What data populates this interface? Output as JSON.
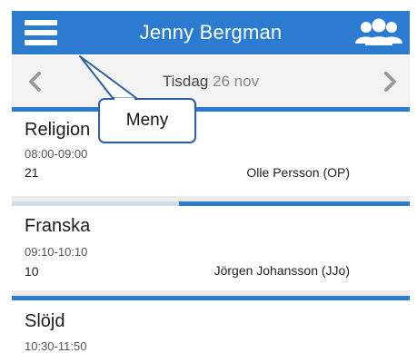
{
  "header": {
    "title": "Jenny Bergman",
    "accent_color": "#2b7cd0",
    "menu_icon": "hamburger-menu-icon",
    "group_icon": "users-group-icon"
  },
  "date_nav": {
    "day": "Tisdag",
    "date": "26 nov",
    "prev_icon": "chevron-left-icon",
    "next_icon": "chevron-right-icon"
  },
  "lessons": [
    {
      "subject": "Religion",
      "time": "08:00-09:00",
      "room": "21",
      "teacher": "Olle Persson (OP)"
    },
    {
      "subject": "Franska",
      "time": "09:10-10:10",
      "room": "10",
      "teacher": "Jörgen Johansson (JJo)"
    },
    {
      "subject": "Slöjd",
      "time": "10:30-11:50",
      "room": "",
      "teacher": ""
    }
  ],
  "callout": {
    "label": "Meny"
  }
}
